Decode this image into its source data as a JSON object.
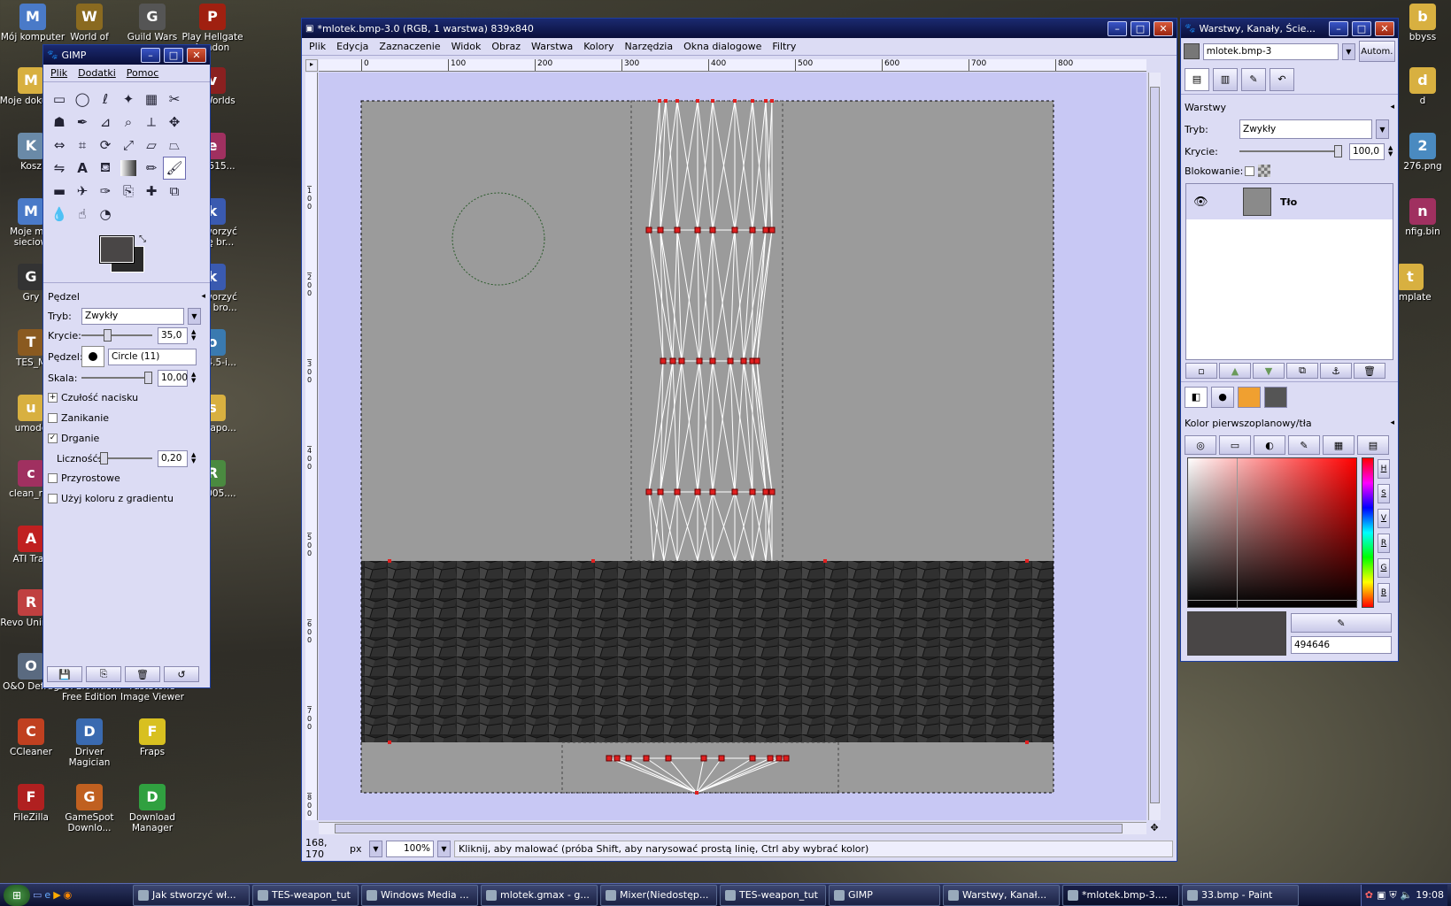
{
  "desktop_icons": [
    {
      "label": "Mój komputer",
      "icon": "computer-icon",
      "color": "#4a7ac8"
    },
    {
      "label": "World of",
      "icon": "wow-icon",
      "color": "#8a6a20"
    },
    {
      "label": "Guild Wars",
      "icon": "guild-wars-icon",
      "color": "#555"
    },
    {
      "label": "Play Hellgate London",
      "icon": "hellgate-icon",
      "color": "#a02010"
    },
    {
      "label": "Moje dokume",
      "icon": "folder-icon",
      "color": "#d8b040"
    },
    {
      "label": "vo Worlds",
      "icon": "app-icon",
      "color": "#8a2020"
    },
    {
      "label": "Kosz",
      "icon": "recycle-bin-icon",
      "color": "#6a8aa8"
    },
    {
      "label": "en-r515...",
      "icon": "winrar-icon",
      "color": "#a03060"
    },
    {
      "label": "Moje mie sieciow",
      "icon": "network-icon",
      "color": "#4a7ac8"
    },
    {
      "label": "k stworzyć asnę br...",
      "icon": "word-doc-icon",
      "color": "#3a5ab0"
    },
    {
      "label": "Gry",
      "icon": "unreal-icon",
      "color": "#333"
    },
    {
      "label": "k stworzyć asnę bro...",
      "icon": "word-doc-icon",
      "color": "#3a5ab0"
    },
    {
      "label": "TES_M",
      "icon": "tes-icon",
      "color": "#8a5a20"
    },
    {
      "label": "o-2.4.5-i...",
      "icon": "installer-icon",
      "color": "#3a7ab0"
    },
    {
      "label": "umode",
      "icon": "folder-icon",
      "color": "#d8b040"
    },
    {
      "label": "s-weapo...",
      "icon": "folder-icon",
      "color": "#d8b040"
    },
    {
      "label": "clean_rec",
      "icon": "winrar-icon",
      "color": "#a03060"
    },
    {
      "label": "RL0005....",
      "icon": "image-icon",
      "color": "#4a8a40"
    },
    {
      "label": "ATI Tray",
      "icon": "ati-tray-icon",
      "color": "#c02020"
    },
    {
      "label": "Revo Uninsta",
      "icon": "revo-icon",
      "color": "#c04040"
    },
    {
      "label": "O&O Defrag",
      "icon": "defrag-icon",
      "color": "#5a6a80"
    },
    {
      "label": "SUPERAntiS... Free Edition",
      "icon": "superantispyware-icon",
      "color": "#308030"
    },
    {
      "label": "FastStone Image Viewer",
      "icon": "faststone-icon",
      "color": "#c03030"
    },
    {
      "label": "CCleaner",
      "icon": "ccleaner-icon",
      "color": "#c04020"
    },
    {
      "label": "Driver Magician",
      "icon": "driver-magician-icon",
      "color": "#3a6ab0"
    },
    {
      "label": "Fraps",
      "icon": "fraps-icon",
      "color": "#d8c020"
    },
    {
      "label": "FileZilla",
      "icon": "filezilla-icon",
      "color": "#b02020"
    },
    {
      "label": "GameSpot Downlo...",
      "icon": "gamespot-icon",
      "color": "#c06020"
    },
    {
      "label": "Download Manager",
      "icon": "download-manager-icon",
      "color": "#30a040"
    },
    {
      "label": "bbyss",
      "icon": "folder-icon",
      "color": "#d8b040"
    },
    {
      "label": "d",
      "icon": "folder-icon",
      "color": "#d8b040"
    },
    {
      "label": "276.png",
      "icon": "image-icon",
      "color": "#4a8ac0"
    },
    {
      "label": "nfig.bin",
      "icon": "winrar-icon",
      "color": "#a03060"
    },
    {
      "label": "template",
      "icon": "folder-icon",
      "color": "#d8b040"
    }
  ],
  "toolbox": {
    "title": "GIMP",
    "menu": [
      "Plik",
      "Dodatki",
      "Pomoc"
    ],
    "tools": [
      "rect-select-icon",
      "ellipse-select-icon",
      "lasso-icon",
      "fuzzy-select-icon",
      "select-by-color-icon",
      "scissors-icon",
      "foreground-select-icon",
      "paths-icon",
      "color-picker-icon",
      "zoom-icon",
      "measure-icon",
      "move-icon",
      "align-icon",
      "crop-icon",
      "rotate-icon",
      "scale-icon",
      "shear-icon",
      "perspective-icon",
      "flip-icon",
      "text-icon",
      "bucket-fill-icon",
      "blend-icon",
      "pencil-icon",
      "paintbrush-icon",
      "eraser-icon",
      "airbrush-icon",
      "ink-icon",
      "clone-icon",
      "heal-icon",
      "perspective-clone-icon",
      "blur-icon",
      "smudge-icon",
      "dodge-burn-icon"
    ],
    "fg_color": "#494646",
    "bg_color": "#2a2a2a",
    "options_title": "Pędzel",
    "mode_label": "Tryb:",
    "mode_value": "Zwykły",
    "opacity_label": "Krycie:",
    "opacity_value": "35,0",
    "opacity_level": 0.35,
    "brush_label": "Pędzel:",
    "brush_value": "Circle (11)",
    "scale_label": "Skala:",
    "scale_value": "10,00",
    "scale_level": 1.0,
    "checks": [
      {
        "label": "Czułość nacisku",
        "expander": true,
        "checked": false
      },
      {
        "label": "Zanikanie",
        "expander": false,
        "checked": false
      },
      {
        "label": "Drganie",
        "expander": false,
        "checked": true
      }
    ],
    "amount_label": "Liczność:",
    "amount_value": "0,20",
    "amount_level": 0.05,
    "checks2": [
      {
        "label": "Przyrostowe",
        "checked": false
      },
      {
        "label": "Użyj koloru z gradientu",
        "checked": false
      }
    ]
  },
  "image_window": {
    "title": "*mlotek.bmp-3.0 (RGB, 1 warstwa) 839x840",
    "menu": [
      "Plik",
      "Edycja",
      "Zaznaczenie",
      "Widok",
      "Obraz",
      "Warstwa",
      "Kolory",
      "Narzędzia",
      "Okna dialogowe",
      "Filtry"
    ],
    "ruler_ticks": [
      "0",
      "100",
      "200",
      "300",
      "400",
      "500",
      "600",
      "700",
      "800"
    ],
    "vruler_ticks": [
      "1\n0\n0",
      "2\n0\n0",
      "3\n0\n0",
      "4\n0\n0",
      "5\n0\n0",
      "6\n0\n0",
      "7\n0\n0",
      "8\n0\n0"
    ],
    "coords": "168, 170",
    "unit": "px",
    "zoom": "100%",
    "status": "Kliknij, aby malować (próba Shift, aby narysować prostą linię, Ctrl aby wybrać kolor)",
    "canvas_gray": "#9b9b9b",
    "stone_color": "#2a2a2a"
  },
  "layers_window": {
    "title": "Warstwy, Kanały, Ście...",
    "image_select": "mlotek.bmp-3",
    "auto_label": "Autom.",
    "panel_title": "Warstwy",
    "mode_label": "Tryb:",
    "mode_value": "Zwykły",
    "opacity_label": "Krycie:",
    "opacity_value": "100,0",
    "opacity_level": 1.0,
    "lock_label": "Blokowanie:",
    "layer_name": "Tło",
    "color_title": "Kolor pierwszoplanowy/tła",
    "hex": "494646",
    "channel_letters": [
      "H",
      "S",
      "V",
      "R",
      "G",
      "B"
    ]
  },
  "taskbar": {
    "items": [
      "Jak stworzyć wł...",
      "TES-weapon_tut",
      "Windows Media ...",
      "mlotek.gmax - g...",
      "Mixer(Niedostęp...",
      "TES-weapon_tut",
      "GIMP",
      "Warstwy, Kanał...",
      "*mlotek.bmp-3....",
      "33.bmp - Paint"
    ],
    "clock": "19:08"
  }
}
